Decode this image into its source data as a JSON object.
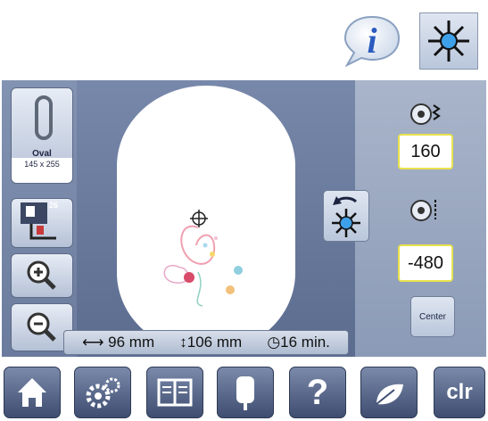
{
  "top_icons": {
    "info": "info-icon",
    "starburst": "needle-center-icon"
  },
  "hoop": {
    "name": "Oval",
    "size": "145 x 255"
  },
  "layers": {
    "count": "26"
  },
  "status": {
    "width": "96 mm",
    "height": "106 mm",
    "time": "16 min."
  },
  "position": {
    "x": "160",
    "y": "-480"
  },
  "center": {
    "label": "Center"
  },
  "toolbar": {
    "help": "?",
    "clear": "clr"
  }
}
